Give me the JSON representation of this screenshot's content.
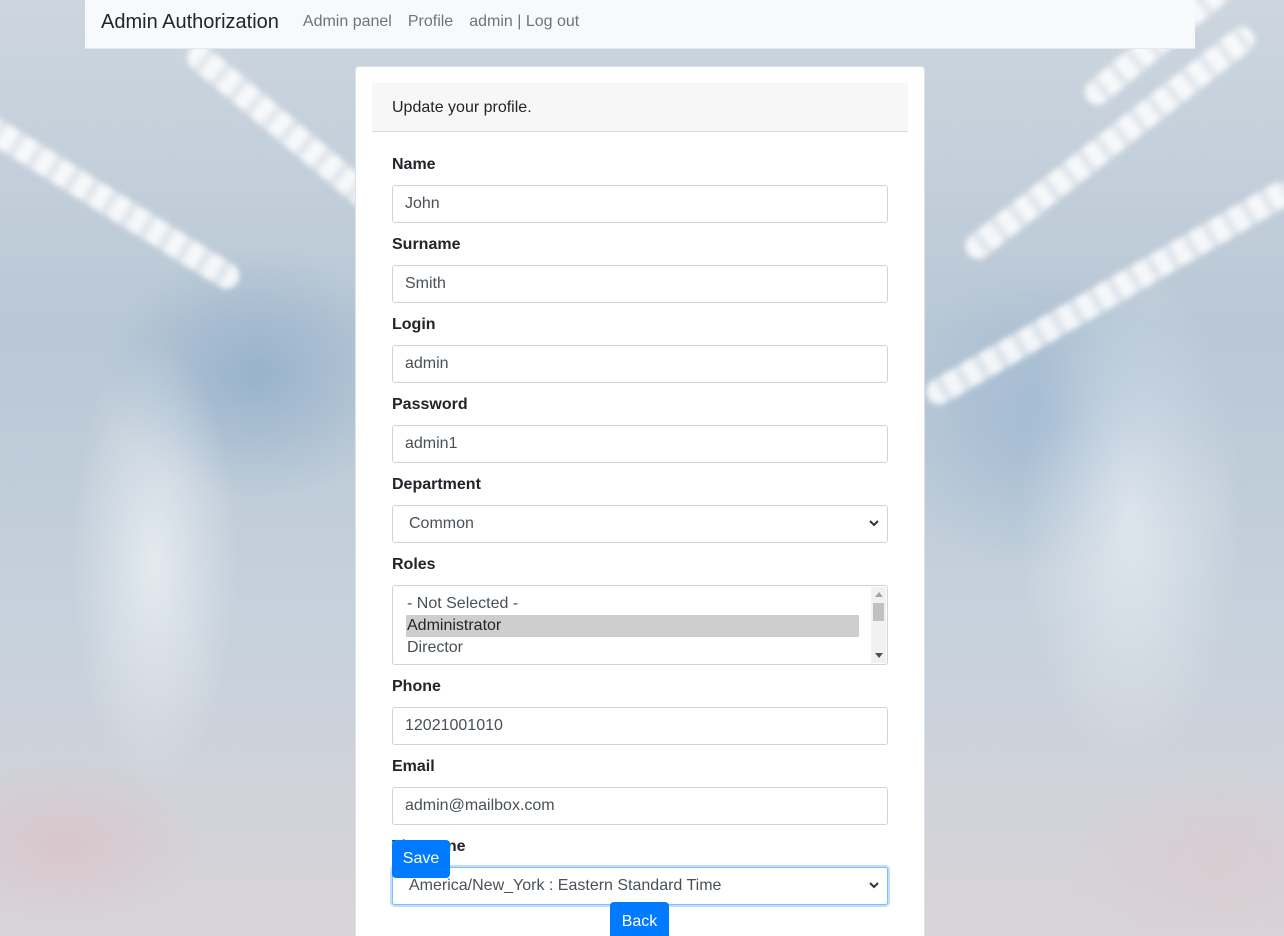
{
  "navbar": {
    "brand": "Admin Authorization",
    "links": [
      "Admin panel",
      "Profile",
      "admin | Log out"
    ]
  },
  "card": {
    "header": "Update your profile."
  },
  "form": {
    "name": {
      "label": "Name",
      "value": "John"
    },
    "surname": {
      "label": "Surname",
      "value": "Smith"
    },
    "login": {
      "label": "Login",
      "value": "admin"
    },
    "password": {
      "label": "Password",
      "value": "admin1"
    },
    "department": {
      "label": "Department",
      "value": "Common"
    },
    "roles": {
      "label": "Roles",
      "options": [
        "- Not Selected -",
        "Administrator",
        "Director"
      ],
      "selected": "Administrator"
    },
    "phone": {
      "label": "Phone",
      "value": "12021001010"
    },
    "email": {
      "label": "Email",
      "value": "admin@mailbox.com"
    },
    "timezone": {
      "label": "Timezone",
      "value": "America/New_York : Eastern Standard Time"
    }
  },
  "buttons": {
    "save": "Save",
    "back": "Back"
  },
  "icons": {
    "select_arrow": "chevron-down-icon",
    "scroll_up": "scroll-up-arrow-icon",
    "scroll_down": "scroll-down-arrow-icon"
  },
  "colors": {
    "primary": "#007bff",
    "navbar_bg": "#f8f9fa",
    "selected_option_bg": "#cecece",
    "focus_border": "#80bdff"
  }
}
